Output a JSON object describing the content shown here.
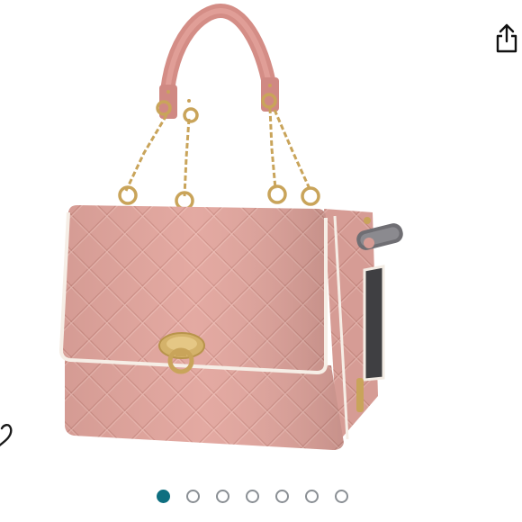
{
  "gallery": {
    "image_count": 7,
    "active_index": 0,
    "accent_color": "#0f6f80",
    "inactive_dot_color": "#8a8f94"
  },
  "icons": {
    "share": "share-icon",
    "edge": "heart-icon"
  },
  "product": {
    "primary_color": "#e0a39b",
    "hardware_color": "#d4b26a",
    "trim_color": "#f6eee6"
  }
}
